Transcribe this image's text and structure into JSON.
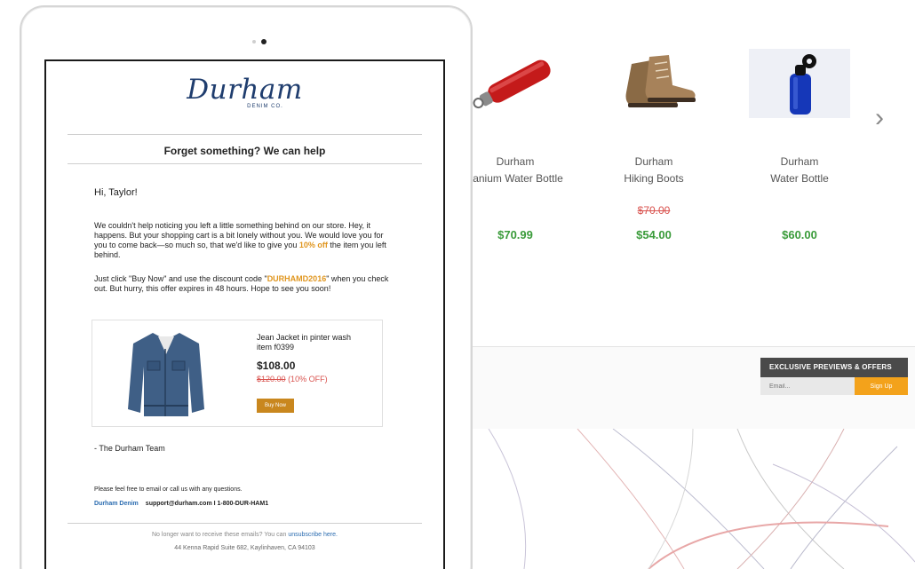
{
  "store": {
    "products": [
      {
        "brand": "Durham",
        "name": "itanium Water Bottle",
        "price": "$70.99",
        "old_price": ""
      },
      {
        "brand": "Durham",
        "name": "Hiking Boots",
        "price": "$54.00",
        "old_price": "$70.00"
      },
      {
        "brand": "Durham",
        "name": "Water Bottle",
        "price": "$60.00",
        "old_price": ""
      }
    ],
    "next_label": "›",
    "offer": {
      "title": "EXCLUSIVE PREVIEWS & OFFERS",
      "email_placeholder": "Email...",
      "signup_label": "Sign Up"
    }
  },
  "email": {
    "logo": {
      "script": "Durham",
      "sub": "DENIM CO."
    },
    "headline": "Forget something? We can help",
    "greeting": "Hi, Taylor!",
    "para1_a": "We couldn't help noticing you left a little something behind on our store. Hey, it happens. But your shopping cart is a bit lonely without you. We would love you for you to come back—so much so, that we'd like to give you ",
    "para1_highlight": "10% off",
    "para1_b": " the item you left behind.",
    "para2_a": "Just click \"Buy Now\" and use the discount code \"",
    "para2_code": "DURHAMD2016",
    "para2_b": "\" when you check out. But hurry, this offer expires in 48 hours. Hope to see you soon!",
    "item": {
      "name": "Jean Jacket in pinter wash",
      "number": "item f0399",
      "price": "$108.00",
      "old_price": "$120.00",
      "discount": "(10% OFF)",
      "buy_label": "Buy Now"
    },
    "signoff": "- The Durham Team",
    "contact_line": "Please feel free to email or call us with any questions.",
    "contact_brand": "Durham Denim",
    "contact_details": "support@durham.com I 1-800-DUR-HAM1",
    "unsubscribe_text": "No longer want to receive these emails? You can ",
    "unsubscribe_link": "unsubscribe here.",
    "address": "44 Kenna Rapid Suite 682, Kaylinhaven, CA 94103"
  }
}
